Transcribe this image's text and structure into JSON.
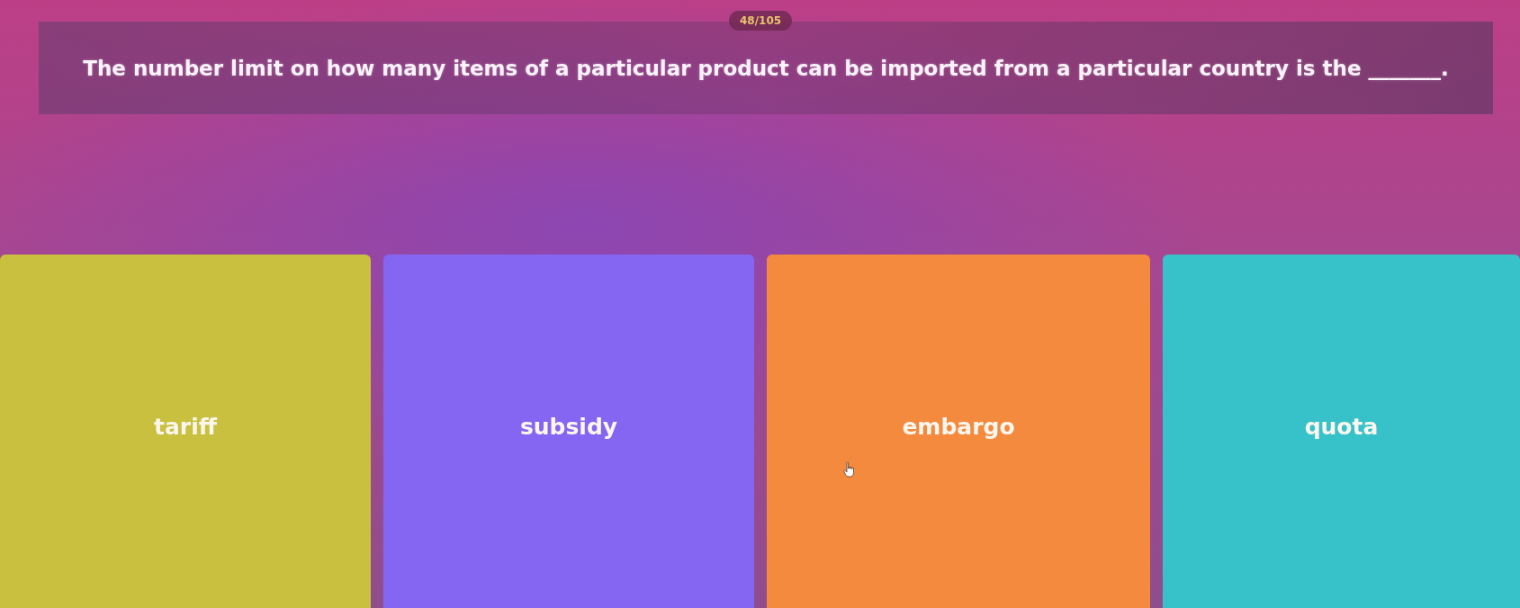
{
  "progress": {
    "counter": "48/105"
  },
  "question": {
    "text": "The number limit on how many items of a particular product can be imported from a particular country is the _______."
  },
  "options": [
    {
      "label": "tariff",
      "color": "#c8c03e"
    },
    {
      "label": "subsidy",
      "color": "#8466f2"
    },
    {
      "label": "embargo",
      "color": "#f38a3e"
    },
    {
      "label": "quota",
      "color": "#36c2c8"
    }
  ]
}
